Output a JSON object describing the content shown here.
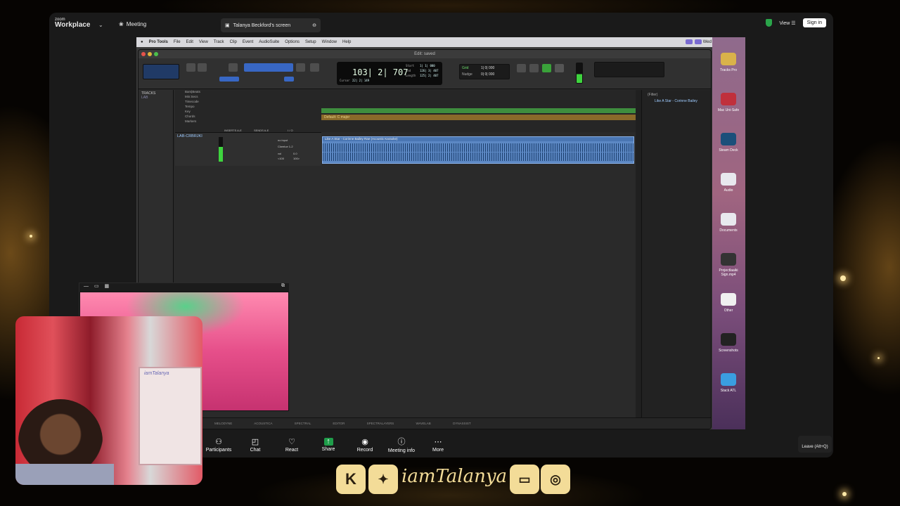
{
  "zoom": {
    "logo_small": "zoom",
    "logo_big": "Workplace",
    "meeting": "Meeting",
    "share_title": "Talanya Beckford's screen",
    "view": "View",
    "sign": "Sign in"
  },
  "mac": {
    "menu": [
      "Pro Tools",
      "File",
      "Edit",
      "View",
      "Track",
      "Clip",
      "Event",
      "AudioSuite",
      "Options",
      "Setup",
      "Window",
      "Help"
    ],
    "clock": "Wed Jan 7  2:31 AM"
  },
  "protools": {
    "title": "Edit: saved",
    "counter": "103| 2| 707",
    "counter_labels": {
      "start": "Start",
      "end": "End",
      "length": "Length",
      "cursor": "Cursor"
    },
    "counter_vals": {
      "start": "1| 1| 000",
      "end": "126| 3| 407",
      "length": "125| 2| 407",
      "cursor": "22| 2| 149"
    },
    "grid": "Grid",
    "nudge": "Nudge",
    "grid_val": "1| 0| 000",
    "nudge_val": "0| 0| 000",
    "tracks_header": "TRACKS",
    "tracks_item": "LAB",
    "rulers": [
      "Bars|Beats",
      "Min:Secs",
      "Timecode",
      "Tempo",
      "Key",
      "Chords",
      "Markers"
    ],
    "tempo_val": "118",
    "key_val": "Default: C major",
    "track_name": "LAB-CRBRJKI",
    "io_headers": [
      "INSERTS A-E",
      "SENDS A-E",
      "I / O"
    ],
    "io_vals": {
      "input": "no input",
      "output": "Ckeelue 1-2",
      "vol": "vol",
      "vol_val": "0.0",
      "pan": "<100",
      "pan_val": "100>"
    },
    "clip_name": "Like A Star - Corinne Bailey Rae (Acoustic Karaoke)",
    "clips_filter": "(Filter)",
    "clips_item": "Like A Star - Corinne Bailey",
    "bottom_tabs": [
      "MELODYNE",
      "ACOUSTICA",
      "SPECTRAL EDITOR",
      "SPECTRALAYERS",
      "WAVELAB",
      "DYNASSIST"
    ]
  },
  "desktop": [
    {
      "label": "Tracks Pro",
      "color": "#d9b24a"
    },
    {
      "label": "Mac Uni-Safe",
      "color": "#c0303c"
    },
    {
      "label": "Steam Deck",
      "color": "#1b4f7a"
    },
    {
      "label": "Audio",
      "color": "#e8e8ee"
    },
    {
      "label": "Documents",
      "color": "#e8e8ee"
    },
    {
      "label": "Projectlaaiki Sign.mp4",
      "color": "#333"
    },
    {
      "label": "Other",
      "color": "#f0f0f0"
    },
    {
      "label": "Screenshots",
      "color": "#222"
    },
    {
      "label": "Stack ATL",
      "color": "#3a9ee0"
    }
  ],
  "zoombar": [
    {
      "label": "Participants",
      "icon": "participants-icon",
      "glyph": "⚇",
      "badge": "2"
    },
    {
      "label": "Chat",
      "icon": "chat-icon",
      "glyph": "◰"
    },
    {
      "label": "React",
      "icon": "react-icon",
      "glyph": "♡"
    },
    {
      "label": "Share",
      "icon": "share-icon",
      "glyph": "↑"
    },
    {
      "label": "Record",
      "icon": "record-icon",
      "glyph": "◉"
    },
    {
      "label": "Meeting info",
      "icon": "info-icon",
      "glyph": "ⓘ"
    },
    {
      "label": "More",
      "icon": "more-icon",
      "glyph": "⋯"
    }
  ],
  "leave": "Leave (Alt+Q)",
  "whiteboard_text": "iamTalanya",
  "social": {
    "k": "K",
    "name": "iamTalanya"
  },
  "colors": {
    "accent": "#3867c4",
    "zoom_share": "#1f9d4a",
    "gold": "#f3dc98"
  }
}
